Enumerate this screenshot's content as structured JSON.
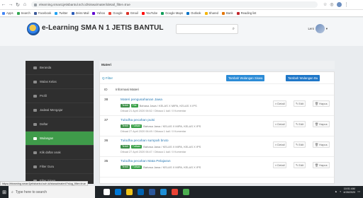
{
  "browser": {
    "url": "elearning.sman1jetisbantul.sch.id/siswa/materi/detail_filter=true",
    "bookmarks": [
      "Apps",
      "Search",
      "Facebook",
      "Twitter",
      "Zeiss Mail",
      "Yahoo",
      "Google",
      "Gmail",
      "YouTube",
      "Google Maps",
      "Outlook",
      "Shared",
      "Bank",
      "Reading list"
    ]
  },
  "app": {
    "title": "e-Learning SMA N 1 JETIS BANTUL",
    "search_placeholder": "",
    "user_name": "Leni"
  },
  "sidebar": {
    "items": [
      {
        "label": "Beranda",
        "active": false
      },
      {
        "label": "Walas Kelas",
        "active": false
      },
      {
        "label": "Profil",
        "active": false
      },
      {
        "label": "Jadwal Mengajar",
        "active": false
      },
      {
        "label": "Daftar",
        "active": false
      },
      {
        "label": "Wulangan",
        "active": true
      },
      {
        "label": "Klik daftar anak",
        "active": false
      },
      {
        "label": "Filter Guru",
        "active": false
      },
      {
        "label": "Filter Siswa",
        "active": false
      }
    ]
  },
  "main": {
    "breadcrumb": "Materi",
    "filter_label": "Q Filter",
    "btn_add_anak": "Tambah Wulangan Siswa",
    "btn_add_info": "Tambah Wulangan Bu",
    "col_num": "ID",
    "col_info": "Informasi Materi",
    "actions": {
      "detail": "Detail",
      "edit": "Edit",
      "delete": "Hapus"
    },
    "rows": [
      {
        "id": "38",
        "title": "Materi pengusahanan Jawa",
        "status": "Terbit",
        "type": "File",
        "tags": "Bahasa Jawa / KELAS X MIPA, KELAS X IPS",
        "meta": "Dibuat 21 April 2020 06:52 / Dibaca 1 kali / 0 Komentar"
      },
      {
        "id": "37",
        "title": "Tulodha pecahan puisi",
        "status": "Terbit",
        "type": "Tulisan",
        "tags": "Bahasa Jawa / KELAS X MIPA, KELAS X IPS",
        "meta": "Dibuat 27 April 2020 06:49 / Dibaca 1 kali / 0 Komentar"
      },
      {
        "id": "36",
        "title": "Tulodha pecahan sumpah bruto",
        "status": "Terbit",
        "type": "Tulisan",
        "tags": "Bahasa Jawa / KELAS X MIPA, KELAS X IPS",
        "meta": "Dibuat 27 April 2020 06:47 / Dibaca 1 kali / 0 Komentar"
      },
      {
        "id": "35",
        "title": "Tulodha pecahan Mata Pelajaran",
        "status": "Terbit",
        "type": "Tulisan",
        "tags": "Bahasa Jawa / KELAS X MIPA, KELAS X IPS",
        "meta": ""
      }
    ]
  },
  "status_url": "https://elearning.sman1jetisbantul.sch.id/siswa/materi/?slug_filter=true",
  "taskbar": {
    "search_placeholder": "Type here to search",
    "time": "10:51 AM",
    "date": "4/28/2020"
  }
}
